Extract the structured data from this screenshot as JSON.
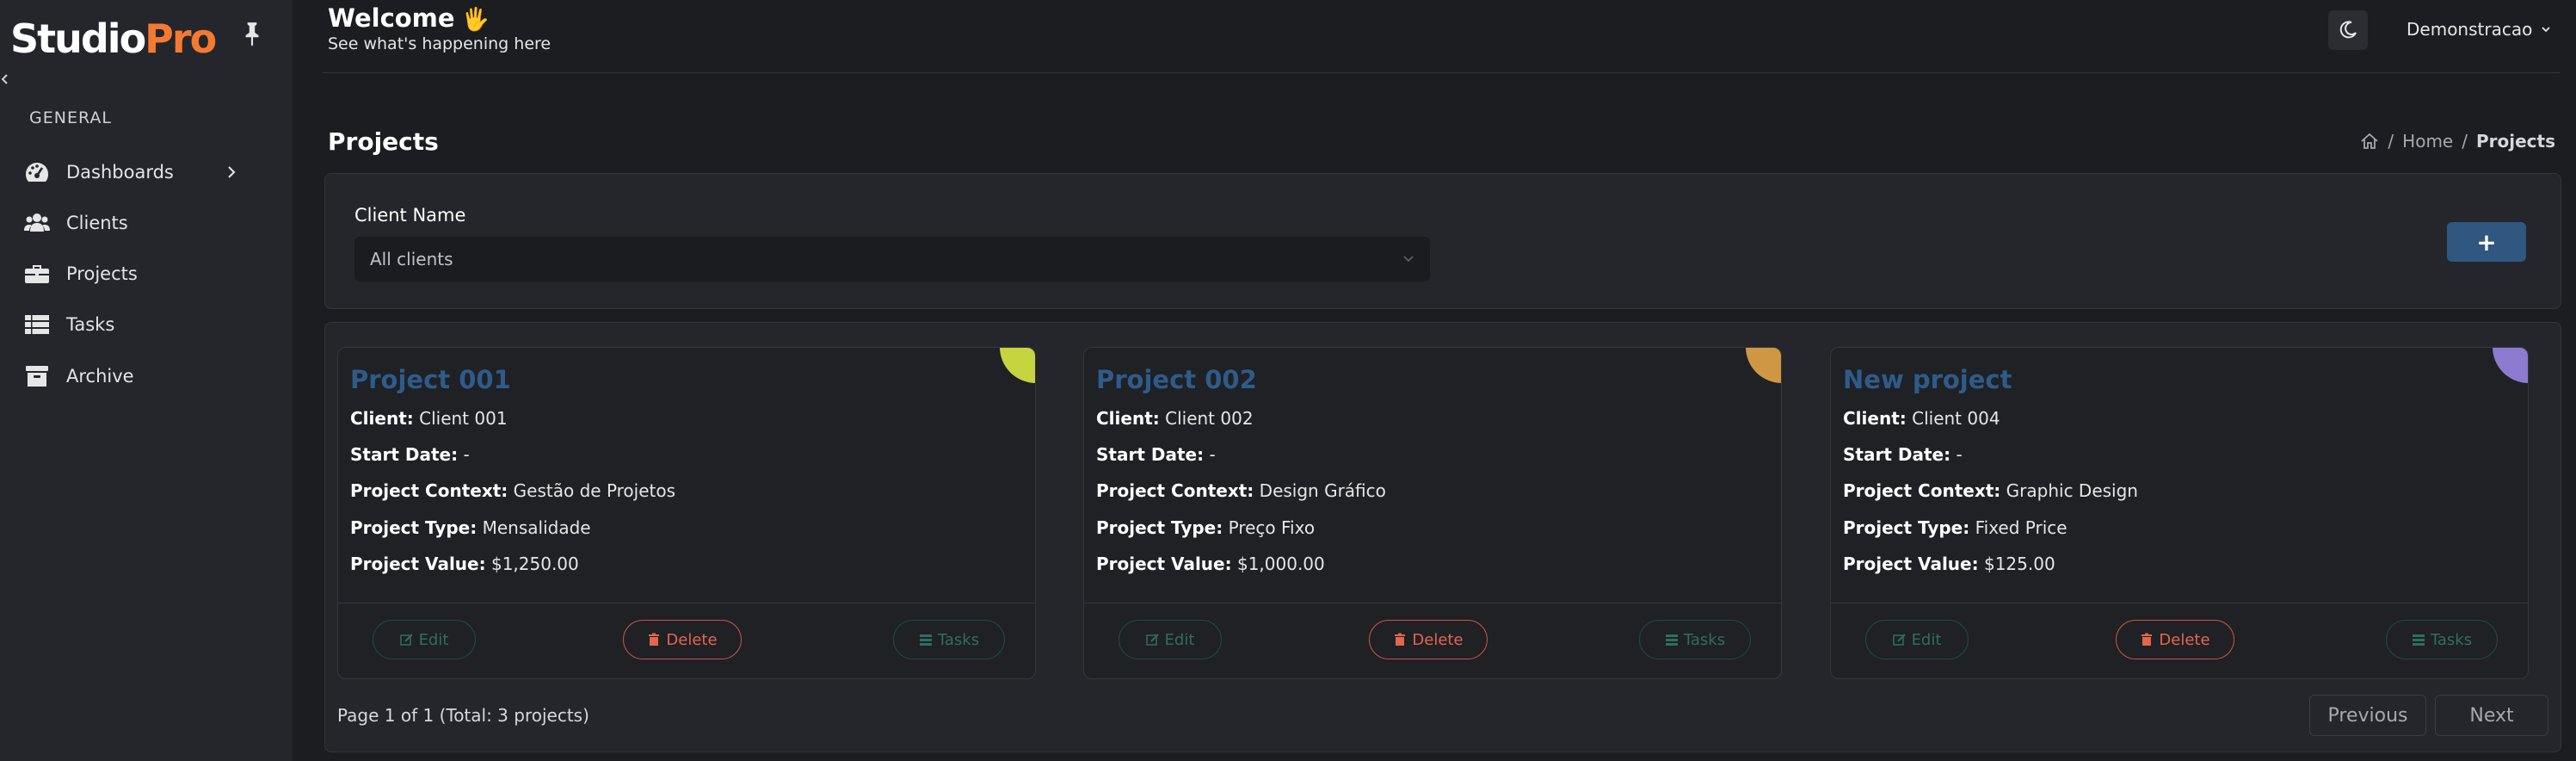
{
  "sidebar": {
    "logo_main": "Studio",
    "logo_accent": "Pro",
    "section": "GENERAL",
    "items": [
      {
        "label": "Dashboards"
      },
      {
        "label": "Clients"
      },
      {
        "label": "Projects"
      },
      {
        "label": "Tasks"
      },
      {
        "label": "Archive"
      }
    ]
  },
  "header": {
    "welcome": "Welcome",
    "wave": "🖐",
    "subtitle": "See what's happening here",
    "user": "Demonstracao"
  },
  "page": {
    "title": "Projects",
    "breadcrumb": {
      "home": "Home",
      "sep": "/",
      "current": "Projects"
    }
  },
  "filter": {
    "label": "Client Name",
    "selected": "All clients",
    "add_label": "+"
  },
  "labels": {
    "client": "Client:",
    "start_date": "Start Date:",
    "context": "Project Context:",
    "type": "Project Type:",
    "value": "Project Value:",
    "edit": "Edit",
    "delete": "Delete",
    "tasks": "Tasks"
  },
  "projects": [
    {
      "title": "Project 001",
      "client": "Client 001",
      "start_date": "-",
      "context": "Gestão de Projetos",
      "type": "Mensalidade",
      "value": "$1,250.00",
      "color": "#c4d53f"
    },
    {
      "title": "Project 002",
      "client": "Client 002",
      "start_date": "-",
      "context": "Design Gráfico",
      "type": "Preço Fixo",
      "value": "$1,000.00",
      "color": "#cf9743"
    },
    {
      "title": "New project",
      "client": "Client 004",
      "start_date": "-",
      "context": "Graphic Design",
      "type": "Fixed Price",
      "value": "$125.00",
      "color": "#8c7bd0"
    }
  ],
  "pagination": {
    "info": "Page 1 of 1 (Total: 3 projects)",
    "previous": "Previous",
    "next": "Next"
  }
}
